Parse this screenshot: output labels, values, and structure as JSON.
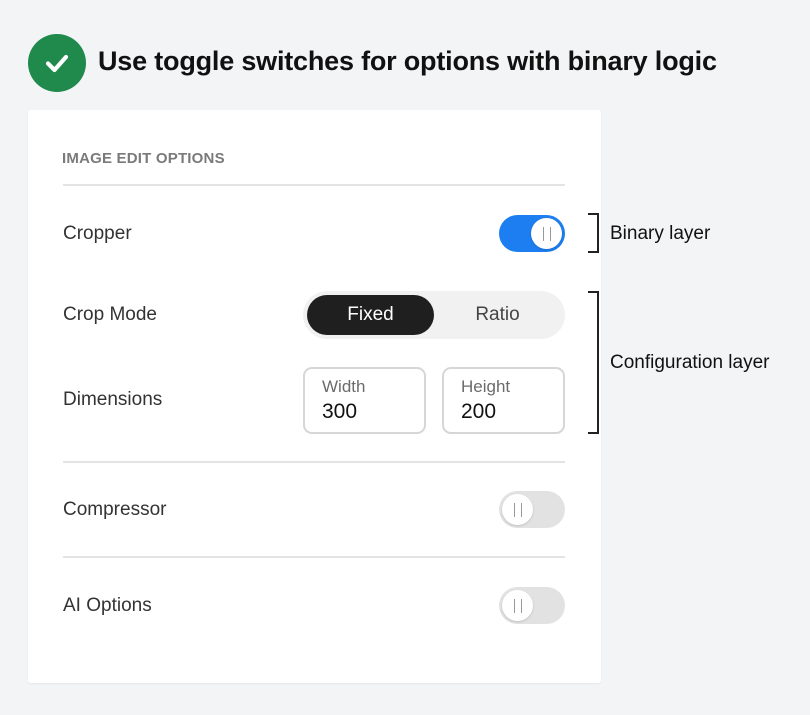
{
  "heading": {
    "icon": "check-circle-icon",
    "icon_color": "#1f8a4c",
    "text": "Use toggle switches for options with binary logic"
  },
  "panel": {
    "section_title": "IMAGE EDIT OPTIONS",
    "cropper": {
      "label": "Cropper",
      "toggle_state": "on",
      "toggle_color": "#1c7ef0"
    },
    "crop_mode": {
      "label": "Crop Mode",
      "options": [
        "Fixed",
        "Ratio"
      ],
      "selected": "Fixed"
    },
    "dimensions": {
      "label": "Dimensions",
      "width": {
        "caption": "Width",
        "value": "300"
      },
      "height": {
        "caption": "Height",
        "value": "200"
      }
    },
    "compressor": {
      "label": "Compressor",
      "toggle_state": "off"
    },
    "ai_options": {
      "label": "AI Options",
      "toggle_state": "off"
    }
  },
  "annotations": {
    "binary_layer": "Binary layer",
    "configuration_layer": "Configuration layer"
  }
}
